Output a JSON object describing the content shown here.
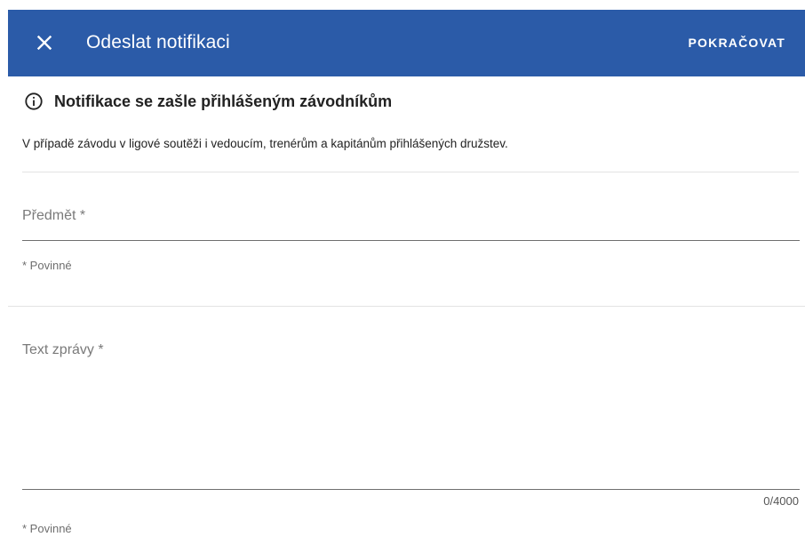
{
  "dialog": {
    "title": "Odeslat notifikaci",
    "continue_label": "POKRAČOVAT",
    "close_icon": "close-icon",
    "header_color": "#2b5ba8"
  },
  "info": {
    "icon": "info-icon",
    "heading": "Notifikace se zašle přihlášeným závodníkům",
    "text": "V případě závodu v ligové soutěži i vedoucím, trenérům a kapitánům přihlášených družstev."
  },
  "form": {
    "subject": {
      "placeholder": "Předmět *",
      "value": "",
      "hint": "* Povinné"
    },
    "message": {
      "placeholder": "Text zprávy *",
      "value": "",
      "counter": "0/4000",
      "hint": "* Povinné"
    }
  }
}
